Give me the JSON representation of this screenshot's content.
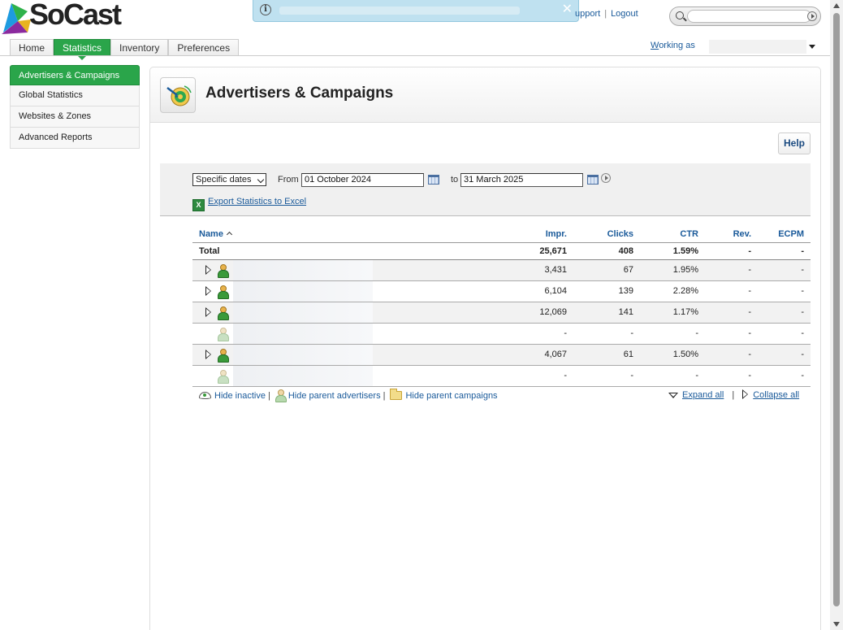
{
  "brand": {
    "logo_text": "SoCast"
  },
  "notice": {
    "close_label": "✕"
  },
  "top_links": {
    "support": "upport",
    "logout": "Logout"
  },
  "search": {
    "placeholder": ""
  },
  "tabs": [
    {
      "label": "Home"
    },
    {
      "label": "Statistics"
    },
    {
      "label": "Inventory"
    },
    {
      "label": "Preferences"
    }
  ],
  "working_as": {
    "label_underlined": "W",
    "label_rest": "orking as"
  },
  "sidebar": {
    "items": [
      {
        "label": "Advertisers & Campaigns"
      },
      {
        "label": "Global Statistics"
      },
      {
        "label": "Websites & Zones"
      },
      {
        "label": "Advanced Reports"
      }
    ]
  },
  "page": {
    "title": "Advertisers & Campaigns",
    "help": "Help"
  },
  "filter": {
    "period": "Specific dates",
    "from_label": "From",
    "from_value": "01 October 2024",
    "to_label": "to",
    "to_value": "31 March 2025",
    "export_label": "Export Statistics to Excel"
  },
  "table": {
    "columns": {
      "name": "Name",
      "impr": "Impr.",
      "clicks": "Clicks",
      "ctr": "CTR",
      "rev": "Rev.",
      "ecpm": "ECPM"
    },
    "total": {
      "name": "Total",
      "impr": "25,671",
      "clicks": "408",
      "ctr": "1.59%",
      "rev": "-",
      "ecpm": "-"
    },
    "rows": [
      {
        "impr": "3,431",
        "clicks": "67",
        "ctr": "1.95%",
        "rev": "-",
        "ecpm": "-"
      },
      {
        "impr": "6,104",
        "clicks": "139",
        "ctr": "2.28%",
        "rev": "-",
        "ecpm": "-"
      },
      {
        "impr": "12,069",
        "clicks": "141",
        "ctr": "1.17%",
        "rev": "-",
        "ecpm": "-"
      },
      {
        "impr": "-",
        "clicks": "-",
        "ctr": "-",
        "rev": "-",
        "ecpm": "-"
      },
      {
        "impr": "4,067",
        "clicks": "61",
        "ctr": "1.50%",
        "rev": "-",
        "ecpm": "-"
      },
      {
        "impr": "-",
        "clicks": "-",
        "ctr": "-",
        "rev": "-",
        "ecpm": "-"
      }
    ]
  },
  "footer": {
    "hide_inactive": "Hide inactive",
    "hide_parent_advertisers": "Hide parent advertisers",
    "hide_parent_campaigns": "Hide parent campaigns",
    "separator": "|",
    "expand_all": "Expand all",
    "collapse_all": "Collapse all"
  }
}
